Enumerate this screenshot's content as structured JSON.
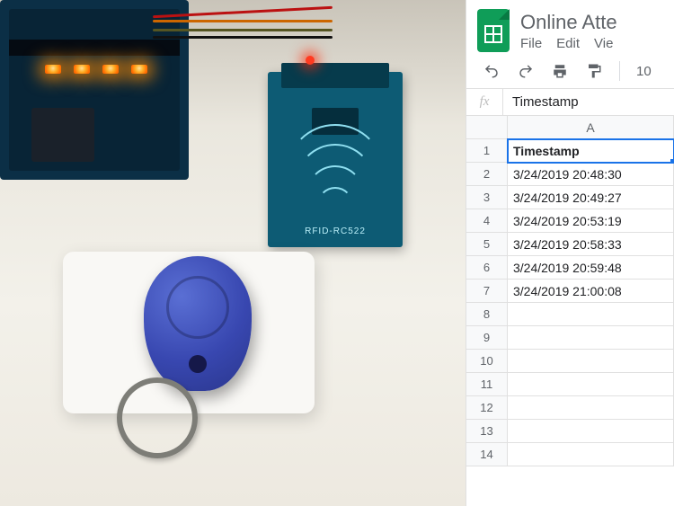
{
  "sheets": {
    "doc_title": "Online Atte",
    "menus": [
      "File",
      "Edit",
      "Vie"
    ],
    "zoom_text": "10",
    "formula_bar": "Timestamp",
    "col_header": "A",
    "rows": {
      "1": "Timestamp",
      "2": "3/24/2019 20:48:30",
      "3": "3/24/2019 20:49:27",
      "4": "3/24/2019 20:53:19",
      "5": "3/24/2019 20:58:33",
      "6": "3/24/2019 20:59:48",
      "7": "3/24/2019 21:00:08",
      "8": "",
      "9": "",
      "10": "",
      "11": "",
      "12": "",
      "13": "",
      "14": ""
    }
  },
  "rfid_label": "RFID-RC522"
}
